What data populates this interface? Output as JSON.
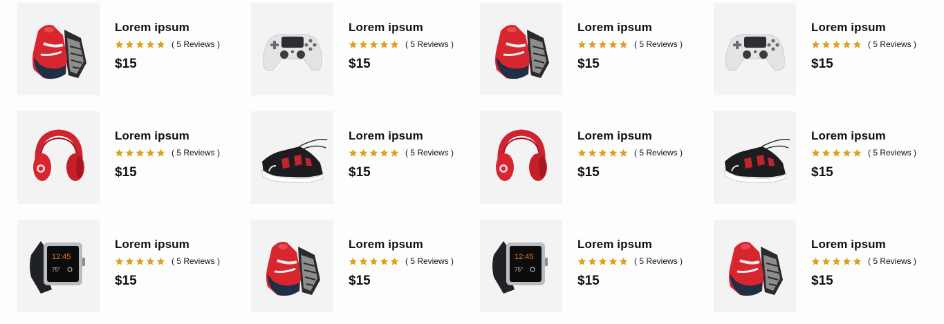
{
  "colors": {
    "star": "#d9a21f",
    "thumb_bg": "#f3f3f3",
    "text": "#111111"
  },
  "products": [
    {
      "name": "Lorem ipsum",
      "reviews": "( 5 Reviews )",
      "price": "$15",
      "rating": 5,
      "image": "red-sneaker-icon"
    },
    {
      "name": "Lorem ipsum",
      "reviews": "( 5 Reviews )",
      "price": "$15",
      "rating": 5,
      "image": "game-controller-icon"
    },
    {
      "name": "Lorem ipsum",
      "reviews": "( 5 Reviews )",
      "price": "$15",
      "rating": 5,
      "image": "red-sneaker-icon"
    },
    {
      "name": "Lorem ipsum",
      "reviews": "( 5 Reviews )",
      "price": "$15",
      "rating": 5,
      "image": "game-controller-icon"
    },
    {
      "name": "Lorem ipsum",
      "reviews": "( 5 Reviews )",
      "price": "$15",
      "rating": 5,
      "image": "red-headphones-icon"
    },
    {
      "name": "Lorem ipsum",
      "reviews": "( 5 Reviews )",
      "price": "$15",
      "rating": 5,
      "image": "black-sneaker-icon"
    },
    {
      "name": "Lorem ipsum",
      "reviews": "( 5 Reviews )",
      "price": "$15",
      "rating": 5,
      "image": "red-headphones-icon"
    },
    {
      "name": "Lorem ipsum",
      "reviews": "( 5 Reviews )",
      "price": "$15",
      "rating": 5,
      "image": "black-sneaker-icon"
    },
    {
      "name": "Lorem ipsum",
      "reviews": "( 5 Reviews )",
      "price": "$15",
      "rating": 5,
      "image": "smartwatch-icon"
    },
    {
      "name": "Lorem ipsum",
      "reviews": "( 5 Reviews )",
      "price": "$15",
      "rating": 5,
      "image": "red-sneaker-icon"
    },
    {
      "name": "Lorem ipsum",
      "reviews": "( 5 Reviews )",
      "price": "$15",
      "rating": 5,
      "image": "smartwatch-icon"
    },
    {
      "name": "Lorem ipsum",
      "reviews": "( 5 Reviews )",
      "price": "$15",
      "rating": 5,
      "image": "red-sneaker-icon"
    }
  ]
}
